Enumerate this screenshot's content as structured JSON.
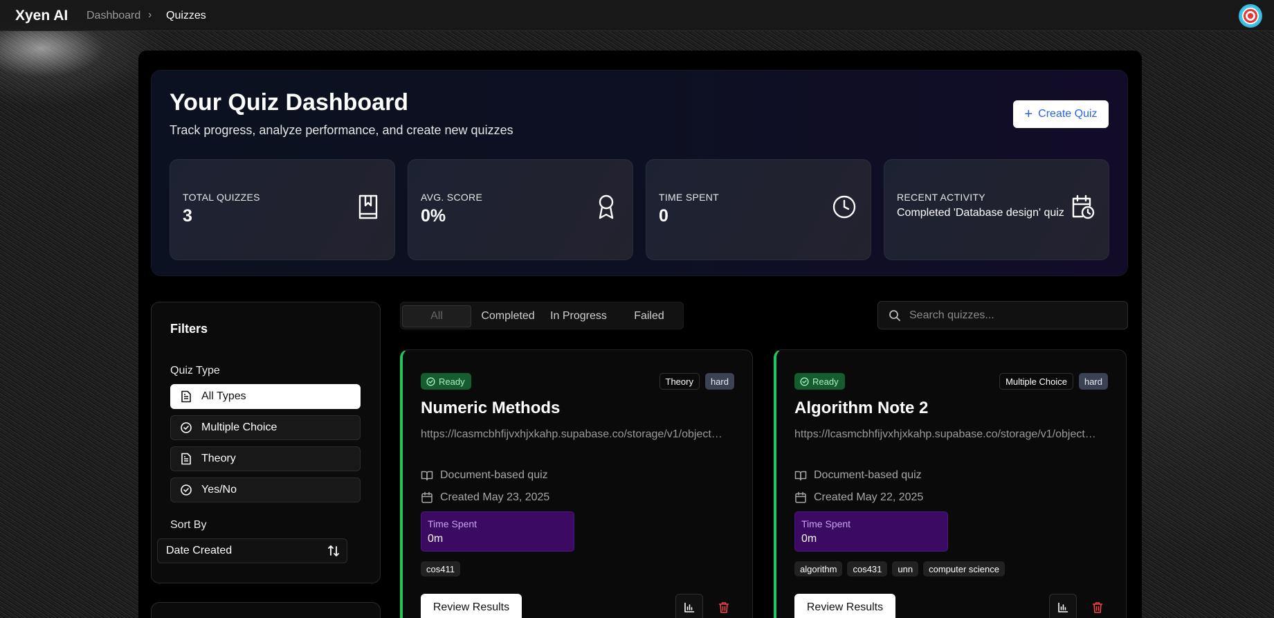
{
  "app": {
    "brand": "Xyen AI"
  },
  "breadcrumb": {
    "parent": "Dashboard",
    "separator": "›",
    "current": "Quizzes"
  },
  "hero": {
    "title": "Your Quiz Dashboard",
    "subtitle": "Track progress, analyze performance, and create new quizzes",
    "create_button": "Create Quiz"
  },
  "stats": [
    {
      "label": "TOTAL QUIZZES",
      "value": "3",
      "icon": "book-icon"
    },
    {
      "label": "AVG. SCORE",
      "value": "0%",
      "icon": "award-icon"
    },
    {
      "label": "TIME SPENT",
      "value": "0",
      "icon": "clock-icon"
    },
    {
      "label": "RECENT ACTIVITY",
      "value": "Completed 'Database design' quiz",
      "icon": "calendar-clock-icon"
    }
  ],
  "filters": {
    "title": "Filters",
    "quiz_type_label": "Quiz Type",
    "types": [
      {
        "label": "All Types",
        "icon": "document-icon",
        "active": true
      },
      {
        "label": "Multiple Choice",
        "icon": "check-circle-icon",
        "active": false
      },
      {
        "label": "Theory",
        "icon": "document-icon",
        "active": false
      },
      {
        "label": "Yes/No",
        "icon": "check-circle-icon",
        "active": false
      }
    ],
    "sort_label": "Sort By",
    "sort_value": "Date Created"
  },
  "tabs": [
    "All",
    "Completed",
    "In Progress",
    "Failed"
  ],
  "active_tab": "All",
  "search": {
    "placeholder": "Search quizzes..."
  },
  "quizzes": [
    {
      "status": "Ready",
      "type": "Theory",
      "difficulty": "hard",
      "title": "Numeric Methods",
      "url": "https://lcasmcbhfijvxhjxkahp.supabase.co/storage/v1/object/public/documents/numeric-methods.pdf",
      "source": "Document-based quiz",
      "created": "Created May 23, 2025",
      "time_label": "Time Spent",
      "time_value": "0m",
      "tags": [
        "cos411"
      ],
      "review_label": "Review Results"
    },
    {
      "status": "Ready",
      "type": "Multiple Choice",
      "difficulty": "hard",
      "title": "Algorithm Note 2",
      "url": "https://lcasmcbhfijvxhjxkahp.supabase.co/storage/v1/object/public/documents/algorithm-note-2.pdf",
      "source": "Document-based quiz",
      "created": "Created May 22, 2025",
      "time_label": "Time Spent",
      "time_value": "0m",
      "tags": [
        "algorithm",
        "cos431",
        "unn",
        "computer science"
      ],
      "review_label": "Review Results"
    }
  ],
  "colors": {
    "accent_green": "#22c55e",
    "ready_badge": "#155c2e",
    "time_box": "#3b0a63",
    "difficulty_badge": "#3a4253",
    "create_text": "#2563eb",
    "delete_red": "#ef4444"
  }
}
